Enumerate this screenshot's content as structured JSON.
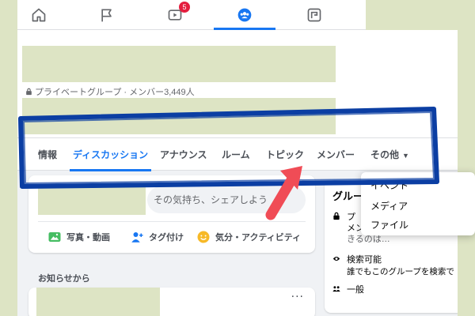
{
  "topnav": {
    "items": [
      {
        "icon": "home-icon"
      },
      {
        "icon": "flag-icon"
      },
      {
        "icon": "video-icon",
        "badge": "5"
      },
      {
        "icon": "groups-icon",
        "active": true
      },
      {
        "icon": "gaming-icon"
      }
    ]
  },
  "group": {
    "privacy_line": "プライベートグループ · メンバー3,449人"
  },
  "tabs": [
    {
      "label": "情報"
    },
    {
      "label": "ディスカッション",
      "active": true
    },
    {
      "label": "アナウンス"
    },
    {
      "label": "ルーム"
    },
    {
      "label": "トピック"
    },
    {
      "label": "メンバー"
    },
    {
      "label": "その他",
      "caret": "▼"
    }
  ],
  "composer": {
    "placeholder": "その気持ち、シェアしよう",
    "actions": [
      {
        "label": "写真・動画",
        "icon": "photo-icon",
        "color": "#45bd62"
      },
      {
        "label": "タグ付け",
        "icon": "tag-people-icon",
        "color": "#1877f2"
      },
      {
        "label": "気分・アクティビティ",
        "icon": "feeling-icon",
        "color": "#f7b928"
      }
    ]
  },
  "announcements_label": "お知らせから",
  "feed": {
    "more": "···"
  },
  "about": {
    "title_fragment": "グルー",
    "private_fragment": "プ",
    "private_line2_fragment": "メン",
    "private_line3_fragment": "きるのは…",
    "visible_title": "検索可能",
    "visible_desc": "誰でもこのグループを検索で",
    "general": "一般"
  },
  "more_menu": {
    "items": [
      "イベント",
      "メディア",
      "ファイル"
    ]
  },
  "colors": {
    "accent": "#1877f2",
    "annotation_box": "#0b3ea3",
    "annotation_arrow": "#f04c56",
    "redaction": "#dde4c4"
  }
}
